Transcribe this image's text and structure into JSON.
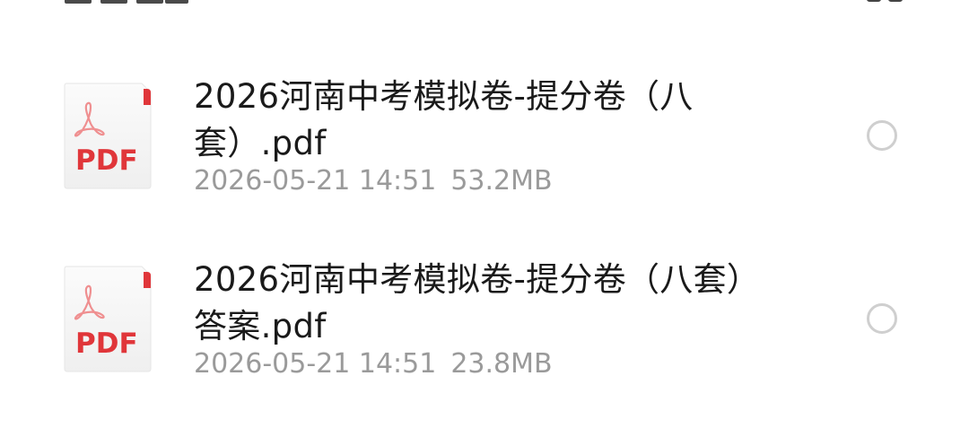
{
  "header": {
    "grid_view_icon": "grid-view-icon"
  },
  "files": [
    {
      "name": "2026河南中考模拟卷-提分卷（八套）.pdf",
      "date": "2026-05-21 14:51",
      "size": "53.2MB",
      "icon": "pdf-file-icon",
      "icon_label": "PDF",
      "selected": false
    },
    {
      "name": "2026河南中考模拟卷-提分卷（八套）答案.pdf",
      "date": "2026-05-21 14:51",
      "size": "23.8MB",
      "icon": "pdf-file-icon",
      "icon_label": "PDF",
      "selected": false
    }
  ],
  "colors": {
    "pdf_red": "#e0363a",
    "radio_border": "#cfcfcf",
    "meta_gray": "#9a9a9a",
    "name_text": "#1a1a1a"
  }
}
